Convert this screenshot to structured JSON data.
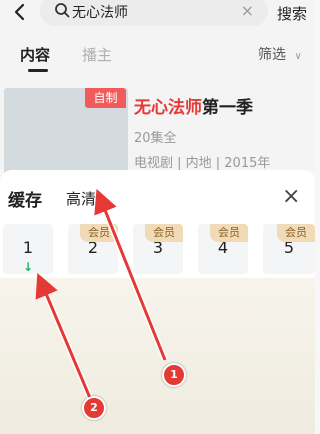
{
  "search": {
    "query": "无心法师",
    "clear_icon": "close-icon",
    "search_label": "搜索"
  },
  "tabs": [
    {
      "label": "内容",
      "active": true
    },
    {
      "label": "播主",
      "active": false
    }
  ],
  "filter": {
    "label": "筛选"
  },
  "result": {
    "badge": "自制",
    "title_highlight": "无心法师",
    "title_rest": "第一季",
    "episodes": "20集全",
    "meta": "电视剧 | 内地 | 2015年"
  },
  "cache_panel": {
    "title": "缓存",
    "quality": "高清",
    "episodes": [
      {
        "number": "1",
        "vip": "",
        "download": "↓"
      },
      {
        "number": "2",
        "vip": "会员",
        "download": ""
      },
      {
        "number": "3",
        "vip": "会员",
        "download": ""
      },
      {
        "number": "4",
        "vip": "会员",
        "download": ""
      },
      {
        "number": "5",
        "vip": "会员",
        "download": ""
      }
    ]
  },
  "annotations": [
    {
      "label": "1"
    },
    {
      "label": "2"
    }
  ],
  "colors": {
    "accent_red": "#e53935",
    "vip_gold": "#f1dbb7",
    "download_green": "#1fb36b"
  }
}
